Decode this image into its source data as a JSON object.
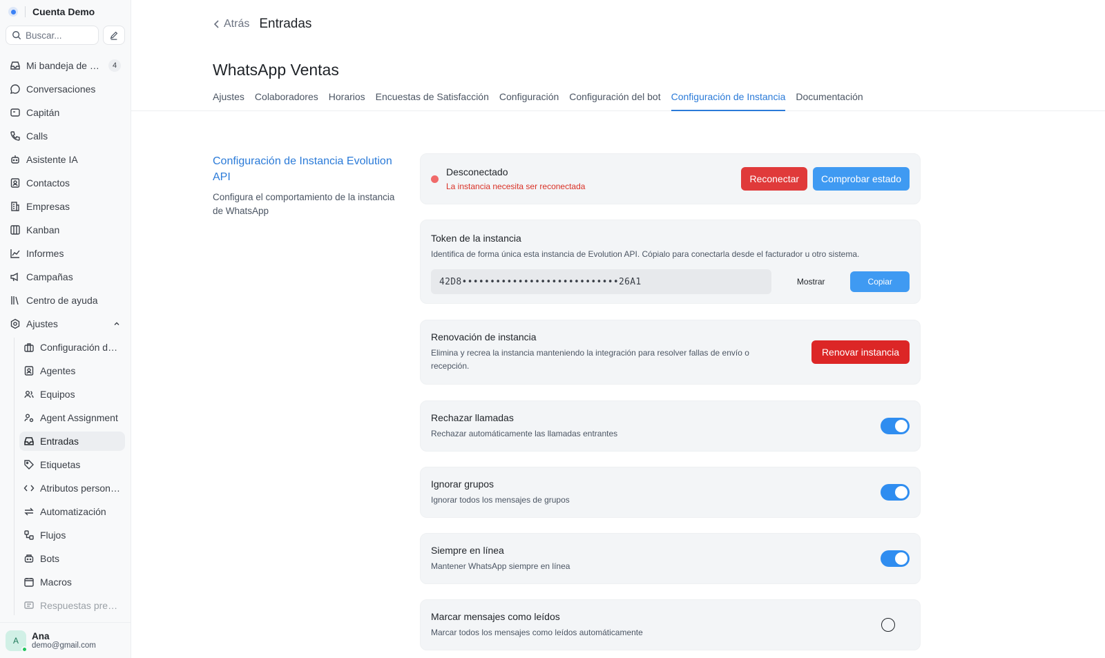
{
  "sidebar": {
    "account_name": "Cuenta Demo",
    "search_placeholder": "Buscar...",
    "items": [
      {
        "label": "Mi bandeja de entrada",
        "icon": "inbox-icon",
        "badge": "4"
      },
      {
        "label": "Conversaciones",
        "icon": "chat-icon"
      },
      {
        "label": "Capitán",
        "icon": "captain-icon"
      },
      {
        "label": "Calls",
        "icon": "phone-icon"
      },
      {
        "label": "Asistente IA",
        "icon": "bot-icon"
      },
      {
        "label": "Contactos",
        "icon": "contacts-icon"
      },
      {
        "label": "Empresas",
        "icon": "building-icon"
      },
      {
        "label": "Kanban",
        "icon": "kanban-icon"
      },
      {
        "label": "Informes",
        "icon": "chart-icon"
      },
      {
        "label": "Campañas",
        "icon": "megaphone-icon"
      },
      {
        "label": "Centro de ayuda",
        "icon": "library-icon"
      },
      {
        "label": "Ajustes",
        "icon": "settings-icon"
      }
    ],
    "settings_items": [
      {
        "label": "Configuración de la cuenta",
        "icon": "briefcase-icon"
      },
      {
        "label": "Agentes",
        "icon": "agent-icon"
      },
      {
        "label": "Equipos",
        "icon": "team-icon"
      },
      {
        "label": "Agent Assignment",
        "icon": "assign-icon"
      },
      {
        "label": "Entradas",
        "icon": "inbox-icon"
      },
      {
        "label": "Etiquetas",
        "icon": "tag-icon"
      },
      {
        "label": "Atributos personalizados",
        "icon": "code-icon"
      },
      {
        "label": "Automatización",
        "icon": "automation-icon"
      },
      {
        "label": "Flujos",
        "icon": "flow-icon"
      },
      {
        "label": "Bots",
        "icon": "bot-icon"
      },
      {
        "label": "Macros",
        "icon": "macro-icon"
      },
      {
        "label": "Respuestas predefinidas",
        "icon": "canned-icon"
      }
    ],
    "user": {
      "initial": "A",
      "name": "Ana",
      "email": "demo@gmail.com"
    }
  },
  "header": {
    "back_label": "Atrás",
    "page_title": "Entradas",
    "inbox_name": "WhatsApp Ventas"
  },
  "tabs": [
    {
      "label": "Ajustes",
      "active": false
    },
    {
      "label": "Colaboradores",
      "active": false
    },
    {
      "label": "Horarios",
      "active": false
    },
    {
      "label": "Encuestas de Satisfacción",
      "active": false
    },
    {
      "label": "Configuración",
      "active": false
    },
    {
      "label": "Configuración del bot",
      "active": false
    },
    {
      "label": "Configuración de Instancia",
      "active": true
    },
    {
      "label": "Documentación",
      "active": false
    }
  ],
  "section": {
    "title": "Configuración de Instancia Evolution API",
    "description": "Configura el comportamiento de la instancia de WhatsApp"
  },
  "status": {
    "title": "Desconectado",
    "subtitle": "La instancia necesita ser reconectada",
    "reconnect_label": "Reconectar",
    "check_label": "Comprobar estado"
  },
  "token": {
    "title": "Token de la instancia",
    "description": "Identifica de forma única esta instancia de Evolution API. Cópialo para conectarla desde el facturador u otro sistema.",
    "value": "42D8••••••••••••••••••••••••••••26A1",
    "show_label": "Mostrar",
    "copy_label": "Copiar"
  },
  "renew": {
    "title": "Renovación de instancia",
    "description": "Elimina y recrea la instancia manteniendo la integración para resolver fallas de envío o recepción.",
    "button_label": "Renovar instancia"
  },
  "toggles": [
    {
      "title": "Rechazar llamadas",
      "description": "Rechazar automáticamente las llamadas entrantes",
      "on": true
    },
    {
      "title": "Ignorar grupos",
      "description": "Ignorar todos los mensajes de grupos",
      "on": true
    },
    {
      "title": "Siempre en línea",
      "description": "Mantener WhatsApp siempre en línea",
      "on": true
    },
    {
      "title": "Marcar mensajes como leídos",
      "description": "Marcar todos los mensajes como leídos automáticamente",
      "on": false
    }
  ],
  "colors": {
    "accent": "#2a7ad8",
    "danger": "#e03a3a",
    "toggle_on": "#2f8df0"
  }
}
